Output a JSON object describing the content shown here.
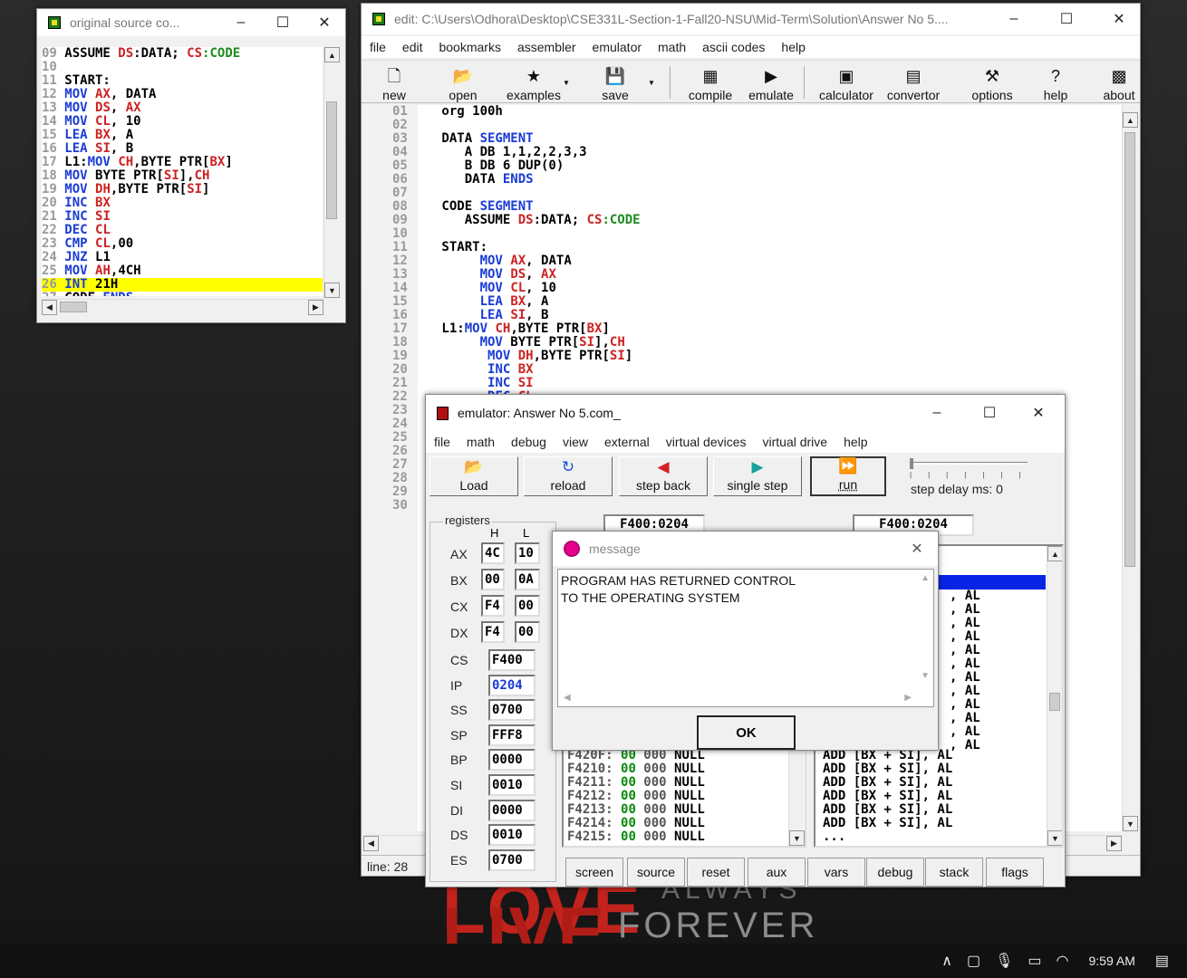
{
  "wallpaper": {
    "red_text": "LIVE",
    "red_text_top": "LOVE",
    "gray_text": "FOREVER",
    "gray_text_top": "ALWAYS"
  },
  "source_window": {
    "title": "original source co...",
    "lines": [
      {
        "n": "09",
        "t": "ASSUME DS:DATA; CS:CODE"
      },
      {
        "n": "10",
        "t": ""
      },
      {
        "n": "11",
        "t": "START:"
      },
      {
        "n": "12",
        "t": "MOV AX, DATA"
      },
      {
        "n": "13",
        "t": "MOV DS, AX"
      },
      {
        "n": "14",
        "t": "MOV CL, 10"
      },
      {
        "n": "15",
        "t": "LEA BX, A"
      },
      {
        "n": "16",
        "t": "LEA SI, B"
      },
      {
        "n": "17",
        "t": "L1:MOV CH,BYTE PTR[BX]"
      },
      {
        "n": "18",
        "t": "MOV BYTE PTR[SI],CH"
      },
      {
        "n": "19",
        "t": "MOV DH,BYTE PTR[SI]"
      },
      {
        "n": "20",
        "t": "INC BX"
      },
      {
        "n": "21",
        "t": "INC SI"
      },
      {
        "n": "22",
        "t": "DEC CL"
      },
      {
        "n": "23",
        "t": "CMP CL,00"
      },
      {
        "n": "24",
        "t": "JNZ L1"
      },
      {
        "n": "25",
        "t": "MOV AH,4CH"
      },
      {
        "n": "26",
        "t": "INT 21H"
      },
      {
        "n": "27",
        "t": "CODE ENDS"
      }
    ],
    "highlight_line": "26"
  },
  "editor_window": {
    "title": "edit: C:\\Users\\Odhora\\Desktop\\CSE331L-Section-1-Fall20-NSU\\Mid-Term\\Solution\\Answer No 5....",
    "menu": [
      "file",
      "edit",
      "bookmarks",
      "assembler",
      "emulator",
      "math",
      "ascii codes",
      "help"
    ],
    "toolbar": [
      {
        "label": "new",
        "icon": "new-file-icon",
        "glyph": "🗋"
      },
      {
        "label": "open",
        "icon": "open-folder-icon",
        "glyph": "📂"
      },
      {
        "label": "examples",
        "icon": "star-icon",
        "glyph": "★"
      },
      {
        "label": "save",
        "icon": "save-disk-icon",
        "glyph": "💾"
      },
      {
        "label": "compile",
        "icon": "compile-icon",
        "glyph": "▦"
      },
      {
        "label": "emulate",
        "icon": "play-icon",
        "glyph": "▶"
      },
      {
        "label": "calculator",
        "icon": "calculator-icon",
        "glyph": "▣"
      },
      {
        "label": "convertor",
        "icon": "convertor-icon",
        "glyph": "▤"
      },
      {
        "label": "options",
        "icon": "tools-icon",
        "glyph": "⚒"
      },
      {
        "label": "help",
        "icon": "help-icon",
        "glyph": "?"
      },
      {
        "label": "about",
        "icon": "chip-icon",
        "glyph": "▩"
      }
    ],
    "line_numbers": [
      "01",
      "02",
      "03",
      "04",
      "05",
      "06",
      "07",
      "08",
      "09",
      "10",
      "11",
      "12",
      "13",
      "14",
      "15",
      "16",
      "17",
      "18",
      "19",
      "20",
      "21",
      "22",
      "23",
      "24",
      "25",
      "26",
      "27",
      "28",
      "29",
      "30"
    ],
    "code": [
      " org 100h",
      "",
      " DATA SEGMENT",
      "    A DB 1,1,2,2,3,3",
      "    B DB 6 DUP(0)",
      "    DATA ENDS",
      "",
      " CODE SEGMENT",
      "    ASSUME DS:DATA; CS:CODE",
      "",
      " START:",
      "      MOV AX, DATA",
      "      MOV DS, AX",
      "      MOV CL, 10",
      "      LEA BX, A",
      "      LEA SI, B",
      " L1:MOV CH,BYTE PTR[BX]",
      "      MOV BYTE PTR[SI],CH",
      "       MOV DH,BYTE PTR[SI]",
      "       INC BX",
      "       INC SI",
      "       DEC CL"
    ],
    "status": "line: 28"
  },
  "emulator_window": {
    "title": "emulator: Answer No 5.com_",
    "menu": [
      "file",
      "math",
      "debug",
      "view",
      "external",
      "virtual devices",
      "virtual drive",
      "help"
    ],
    "buttons": [
      {
        "label": "Load",
        "icon": "load-folder-icon",
        "glyph": "📂"
      },
      {
        "label": "reload",
        "icon": "reload-icon",
        "glyph": "↻"
      },
      {
        "label": "step back",
        "icon": "step-back-icon",
        "glyph": "◀"
      },
      {
        "label": "single step",
        "icon": "single-step-icon",
        "glyph": "▶"
      },
      {
        "label": "run",
        "icon": "run-icon",
        "glyph": "⏩"
      }
    ],
    "step_delay": "step delay ms: 0",
    "registers_title": "registers",
    "h_label": "H",
    "l_label": "L",
    "regs_hl": [
      {
        "name": "AX",
        "h": "4C",
        "l": "10"
      },
      {
        "name": "BX",
        "h": "00",
        "l": "0A"
      },
      {
        "name": "CX",
        "h": "F4",
        "l": "00"
      },
      {
        "name": "DX",
        "h": "F4",
        "l": "00"
      }
    ],
    "regs": [
      {
        "name": "CS",
        "v": "F400"
      },
      {
        "name": "IP",
        "v": "0204"
      },
      {
        "name": "SS",
        "v": "0700"
      },
      {
        "name": "SP",
        "v": "FFF8"
      },
      {
        "name": "BP",
        "v": "0000"
      },
      {
        "name": "SI",
        "v": "0010"
      },
      {
        "name": "DI",
        "v": "0000"
      },
      {
        "name": "DS",
        "v": "0010"
      },
      {
        "name": "ES",
        "v": "0700"
      }
    ],
    "addr_left": "F400:0204",
    "addr_right": "F400:0204",
    "memory": [
      {
        "a": "F420F:",
        "b": "00",
        "c": "000",
        "d": "NULL"
      },
      {
        "a": "F4210:",
        "b": "00",
        "c": "000",
        "d": "NULL"
      },
      {
        "a": "F4211:",
        "b": "00",
        "c": "000",
        "d": "NULL"
      },
      {
        "a": "F4212:",
        "b": "00",
        "c": "000",
        "d": "NULL"
      },
      {
        "a": "F4213:",
        "b": "00",
        "c": "000",
        "d": "NULL"
      },
      {
        "a": "F4214:",
        "b": "00",
        "c": "000",
        "d": "NULL"
      },
      {
        "a": "F4215:",
        "b": "00",
        "c": "000",
        "d": "NULL"
      }
    ],
    "disasm_al": ", AL",
    "disasm": [
      "ADD [BX + SI], AL",
      "ADD [BX + SI], AL",
      "ADD [BX + SI], AL",
      "ADD [BX + SI], AL",
      "ADD [BX + SI], AL",
      "ADD [BX + SI], AL",
      "..."
    ],
    "bottom_buttons": [
      "screen",
      "source",
      "reset",
      "aux",
      "vars",
      "debug",
      "stack",
      "flags"
    ]
  },
  "message_dialog": {
    "title": "message",
    "text_line1": "PROGRAM HAS RETURNED CONTROL",
    "text_line2": "TO THE OPERATING SYSTEM",
    "ok": "OK"
  },
  "taskbar": {
    "time": "9:59 AM"
  }
}
